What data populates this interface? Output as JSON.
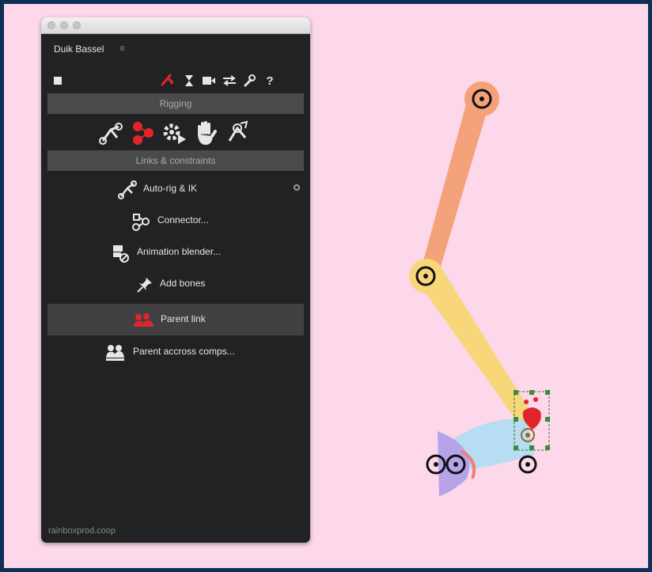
{
  "panel": {
    "tab_title": "Duik Bassel",
    "menu_glyph": "≡",
    "footer": "rainboxprod.coop"
  },
  "toolbar": {
    "icons": [
      "stop-icon",
      "rigging-icon",
      "hourglass-icon",
      "camera-icon",
      "swap-arrows-icon",
      "wrench-icon",
      "help-icon"
    ],
    "help_label": "?"
  },
  "sections": {
    "rigging": "Rigging",
    "links": "Links & constraints"
  },
  "categories": [
    "bones-tool-icon",
    "links-constraints-icon",
    "automation-gear-icon",
    "hand-icon",
    "camera-tools-icon"
  ],
  "menu": {
    "items": [
      {
        "label": "Auto-rig & IK",
        "icon": "autorig-icon"
      },
      {
        "label": "Connector...",
        "icon": "connector-icon"
      },
      {
        "label": "Animation blender...",
        "icon": "animation-blender-icon"
      },
      {
        "label": "Add bones",
        "icon": "pushpin-icon"
      },
      {
        "label": "Parent link",
        "icon": "parent-link-icon",
        "active": true
      },
      {
        "label": "Parent accross comps...",
        "icon": "parent-across-comps-icon"
      }
    ]
  },
  "colors": {
    "canvas_bg": "#fcd8ea",
    "panel_bg": "#222224",
    "accent_red": "#e0262b",
    "bone_orange": "#f4a27a",
    "bone_yellow": "#f7d77a",
    "bone_blue": "#b8dcf2",
    "bone_purple": "#b6a3e8"
  }
}
